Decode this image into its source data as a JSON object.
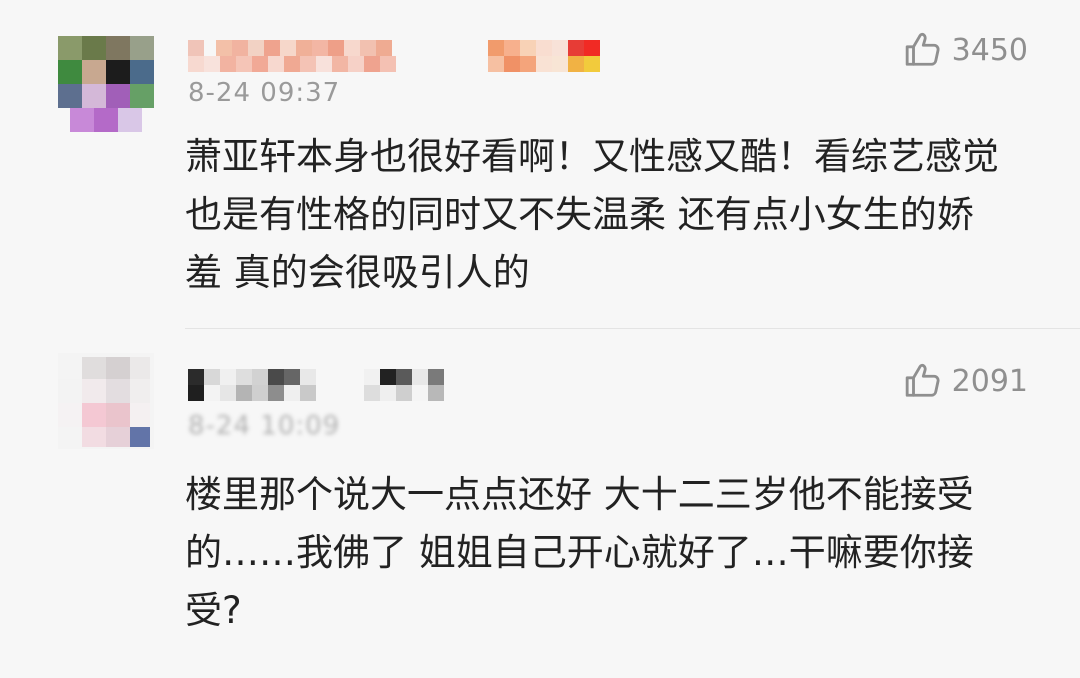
{
  "comments": [
    {
      "timestamp": "8-24 09:37",
      "likes": "3450",
      "text": "萧亚轩本身也很好看啊！又性感又酷！看综艺感觉也是有性格的同时又不失温柔 还有点小女生的娇羞 真的会很吸引人的"
    },
    {
      "timestamp": "8-24 10:09",
      "likes": "2091",
      "text": "楼里那个说大一点点还好 大十二三岁他不能接受的……我佛了  姐姐自己开心就好了…干嘛要你接受?"
    }
  ],
  "icons": {
    "like": "thumbs-up-icon"
  },
  "colors": {
    "background": "#f7f7f7",
    "text": "#222222",
    "meta": "#9a9a9a",
    "like": "#8f8f8f"
  }
}
